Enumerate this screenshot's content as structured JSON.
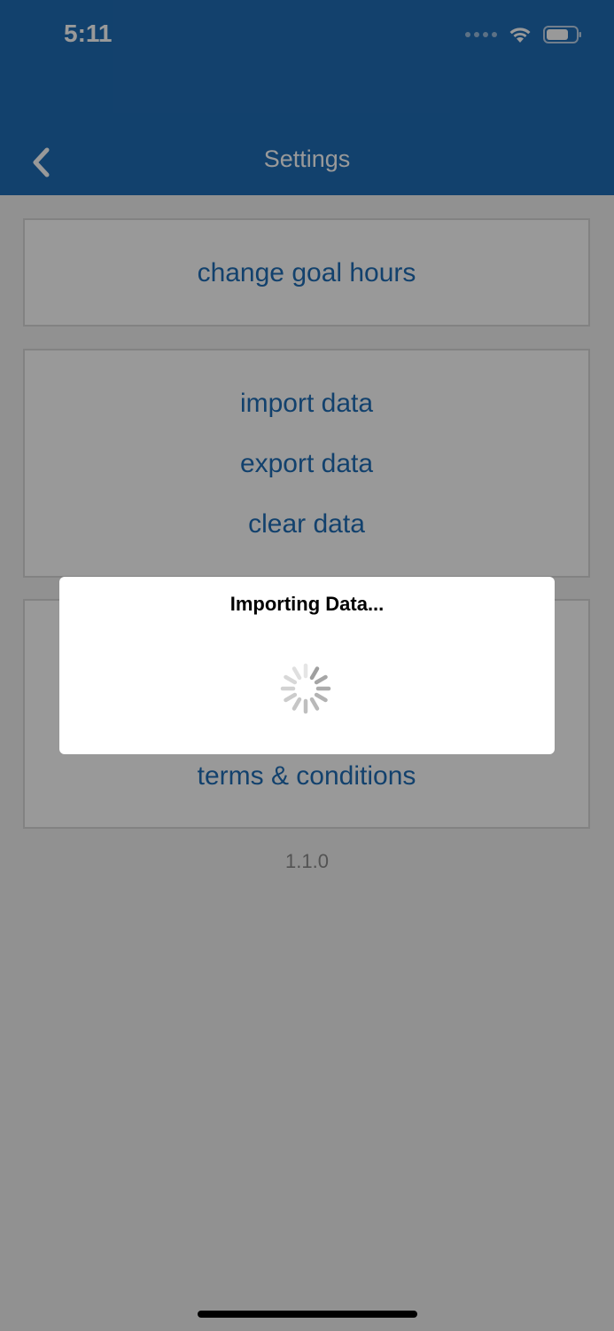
{
  "status_bar": {
    "time": "5:11",
    "wifi_icon": "wifi-icon",
    "battery_icon": "battery-icon"
  },
  "nav": {
    "title": "Settings",
    "back_icon": "chevron-left-icon"
  },
  "sections": {
    "goal": {
      "change_goal_hours": "change goal hours"
    },
    "data": {
      "import": "import data",
      "export": "export data",
      "clear": "clear data"
    },
    "legal": {
      "terms": "terms & conditions"
    }
  },
  "version": "1.1.0",
  "modal": {
    "title": "Importing Data...",
    "spinner_icon": "activity-spinner-icon"
  },
  "colors": {
    "header": "#1f6db6",
    "link": "#1f6db6",
    "background": "#f2f2f2",
    "overlay": "rgba(0,0,0,0.4)"
  }
}
